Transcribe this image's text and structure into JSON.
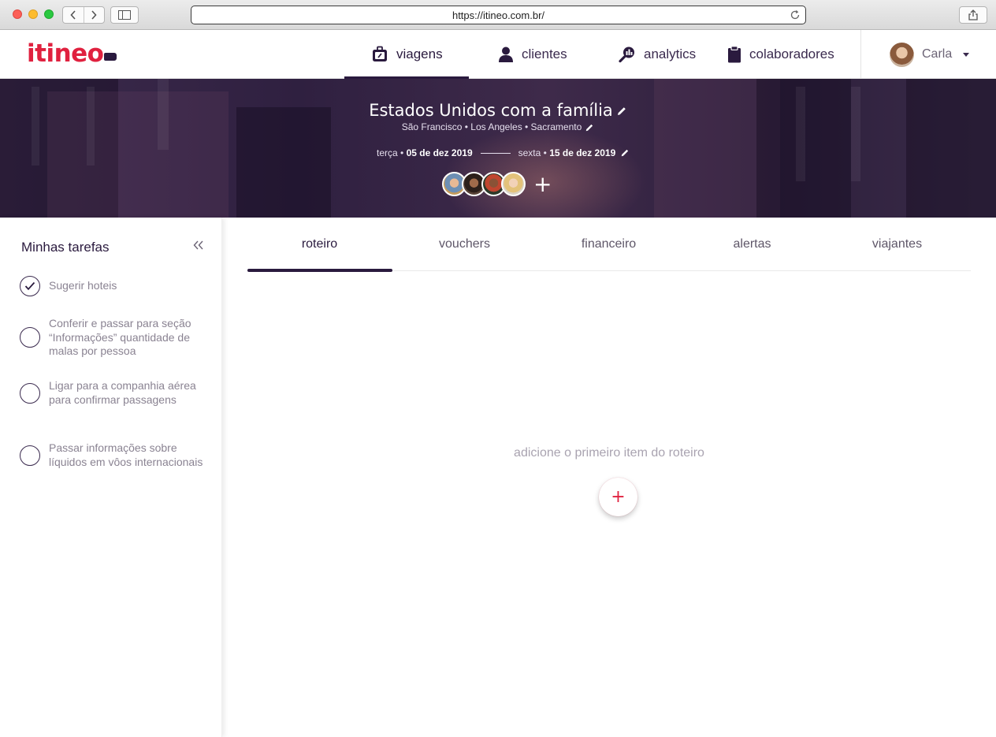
{
  "browser": {
    "url": "https://itineo.com.br/"
  },
  "header": {
    "logo": "itineo",
    "nav": [
      {
        "label": "viagens",
        "icon": "suitcase-icon",
        "active": true
      },
      {
        "label": "clientes",
        "icon": "user-icon",
        "active": false
      },
      {
        "label": "analytics",
        "icon": "magnifier-chart-icon",
        "active": false
      },
      {
        "label": "colaboradores",
        "icon": "clipboard-icon",
        "active": false
      }
    ],
    "user": {
      "name": "Carla"
    }
  },
  "trip": {
    "title": "Estados Unidos com a família",
    "cities": "São Francisco • Los Angeles • Sacramento",
    "start_day": "terça •",
    "start_date": "05 de dez 2019",
    "end_day": "sexta •",
    "end_date": "15 de dez 2019",
    "add_traveler": "+"
  },
  "sidebar": {
    "title": "Minhas tarefas",
    "collapse_label": "<<",
    "tasks": [
      {
        "text": "Sugerir hoteis",
        "done": true
      },
      {
        "text": "Conferir e passar para seção “Informações” quantidade de malas por pessoa",
        "done": false
      },
      {
        "text": "Ligar para a companhia aérea para confirmar passagens",
        "done": false
      },
      {
        "text": "Passar informações sobre líquidos em vôos internacionais",
        "done": false
      }
    ]
  },
  "main": {
    "tabs": [
      {
        "label": "roteiro",
        "active": true
      },
      {
        "label": "vouchers",
        "active": false
      },
      {
        "label": "financeiro",
        "active": false
      },
      {
        "label": "alertas",
        "active": false
      },
      {
        "label": "viajantes",
        "active": false
      }
    ],
    "empty_message": "adicione o primeiro item do roteiro",
    "add_button": "+"
  },
  "colors": {
    "brand_red": "#e0213f",
    "brand_dark": "#2a1a3e",
    "hero_bg": "#2f2040"
  }
}
